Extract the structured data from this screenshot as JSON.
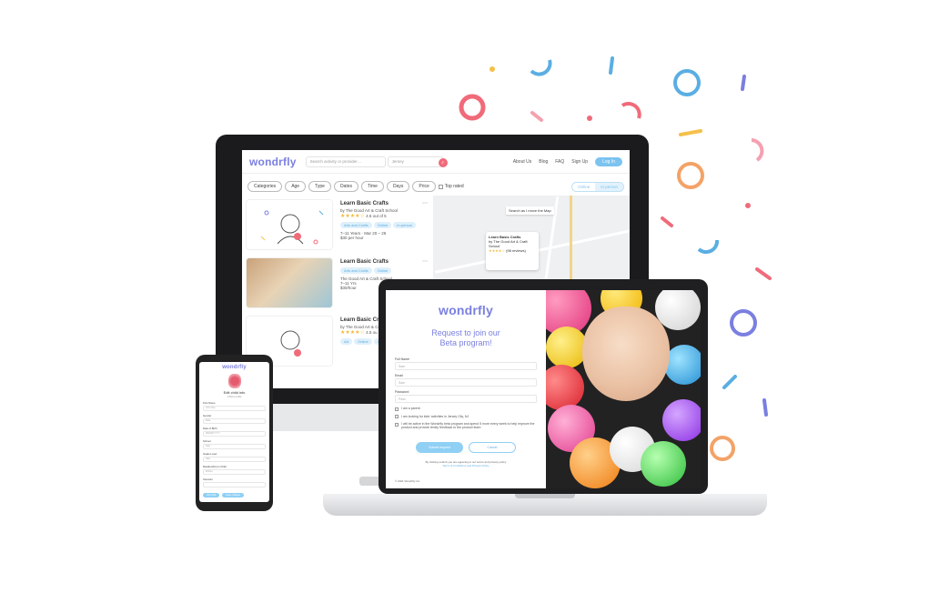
{
  "brand": {
    "logo_text": "wondrfly",
    "accent": "#7a7fe0",
    "sky": "#7cc3f0",
    "coral": "#f06b7a"
  },
  "monitor": {
    "search_placeholder": "Search activity or provider…",
    "location_value": "Jersey",
    "nav": [
      "About Us",
      "Blog",
      "FAQ",
      "Sign Up"
    ],
    "nav_pill": "Log In",
    "filters": [
      "Categories",
      "Age",
      "Type",
      "Dates",
      "Time",
      "Days",
      "Price"
    ],
    "top_rated": "Top rated",
    "toggle": [
      "Online",
      "In person"
    ],
    "map_hint": "Search as I move the Map",
    "popup_title": "Learn Basic Crafts",
    "popup_by": "by The Good Art & Craft School",
    "popup_reviews": "(98 reviews)",
    "listings": [
      {
        "title": "Learn Basic Crafts",
        "by": "by The Good Art & Craft School",
        "rating": "4.5 out of 5",
        "tags": [
          "Arts and Crafts",
          "Online",
          "In-person"
        ],
        "age": "7–11 Years",
        "dates": "Mar 20 – 26",
        "price": "$30 per hour"
      },
      {
        "title": "Learn Basic Crafts",
        "by": "The Good Art & Craft School",
        "rating": "",
        "tags": [
          "Arts and Crafts",
          "Online"
        ],
        "age": "7–11 Yrs",
        "dates": "",
        "price": "$30/hour"
      },
      {
        "title": "Learn Basic Crafts",
        "by": "by The Good Art & Craft School",
        "rating": "4.5 ou",
        "tags": [
          "Art",
          "Online",
          "In"
        ],
        "age": "",
        "dates": "",
        "price": ""
      }
    ]
  },
  "laptop": {
    "title_line1": "Request to join our",
    "title_line2": "Beta program!",
    "fields": [
      {
        "label": "Full Name",
        "placeholder": "Sam"
      },
      {
        "label": "Email",
        "placeholder": "Sam"
      },
      {
        "label": "Password",
        "placeholder": "Pass"
      }
    ],
    "checkboxes": [
      "I am a parent",
      "I am looking for kids' activities in Jersey City, NJ",
      "I will be active in the Wondrfly beta program and spend 5 more every week to help improve the product and provide timely feedback to the product team"
    ],
    "submit": "Submit request",
    "cancel": "Cancel",
    "small_print": "By clicking submit you are agreeing to our terms and privacy policy",
    "small_links": "Terms & Conditions and Privacy Policy",
    "copyright": "© 2021 Wondrfly Inc."
  },
  "phone": {
    "title": "Edit child info",
    "subtitle": "Child profile",
    "fields": [
      {
        "label": "First Name",
        "value": "John Doe"
      },
      {
        "label": "Gender",
        "value": "Male"
      },
      {
        "label": "Date of Birth",
        "value": "MM/DD/YYYY"
      },
      {
        "label": "School",
        "value": "Sate"
      },
      {
        "label": "Grade Level",
        "value": "Sate"
      },
      {
        "label": "Relationship to Child",
        "value": "Mother"
      },
      {
        "label": "Interests",
        "value": ""
      }
    ],
    "buttons": [
      "Add child",
      "Save changes"
    ]
  }
}
